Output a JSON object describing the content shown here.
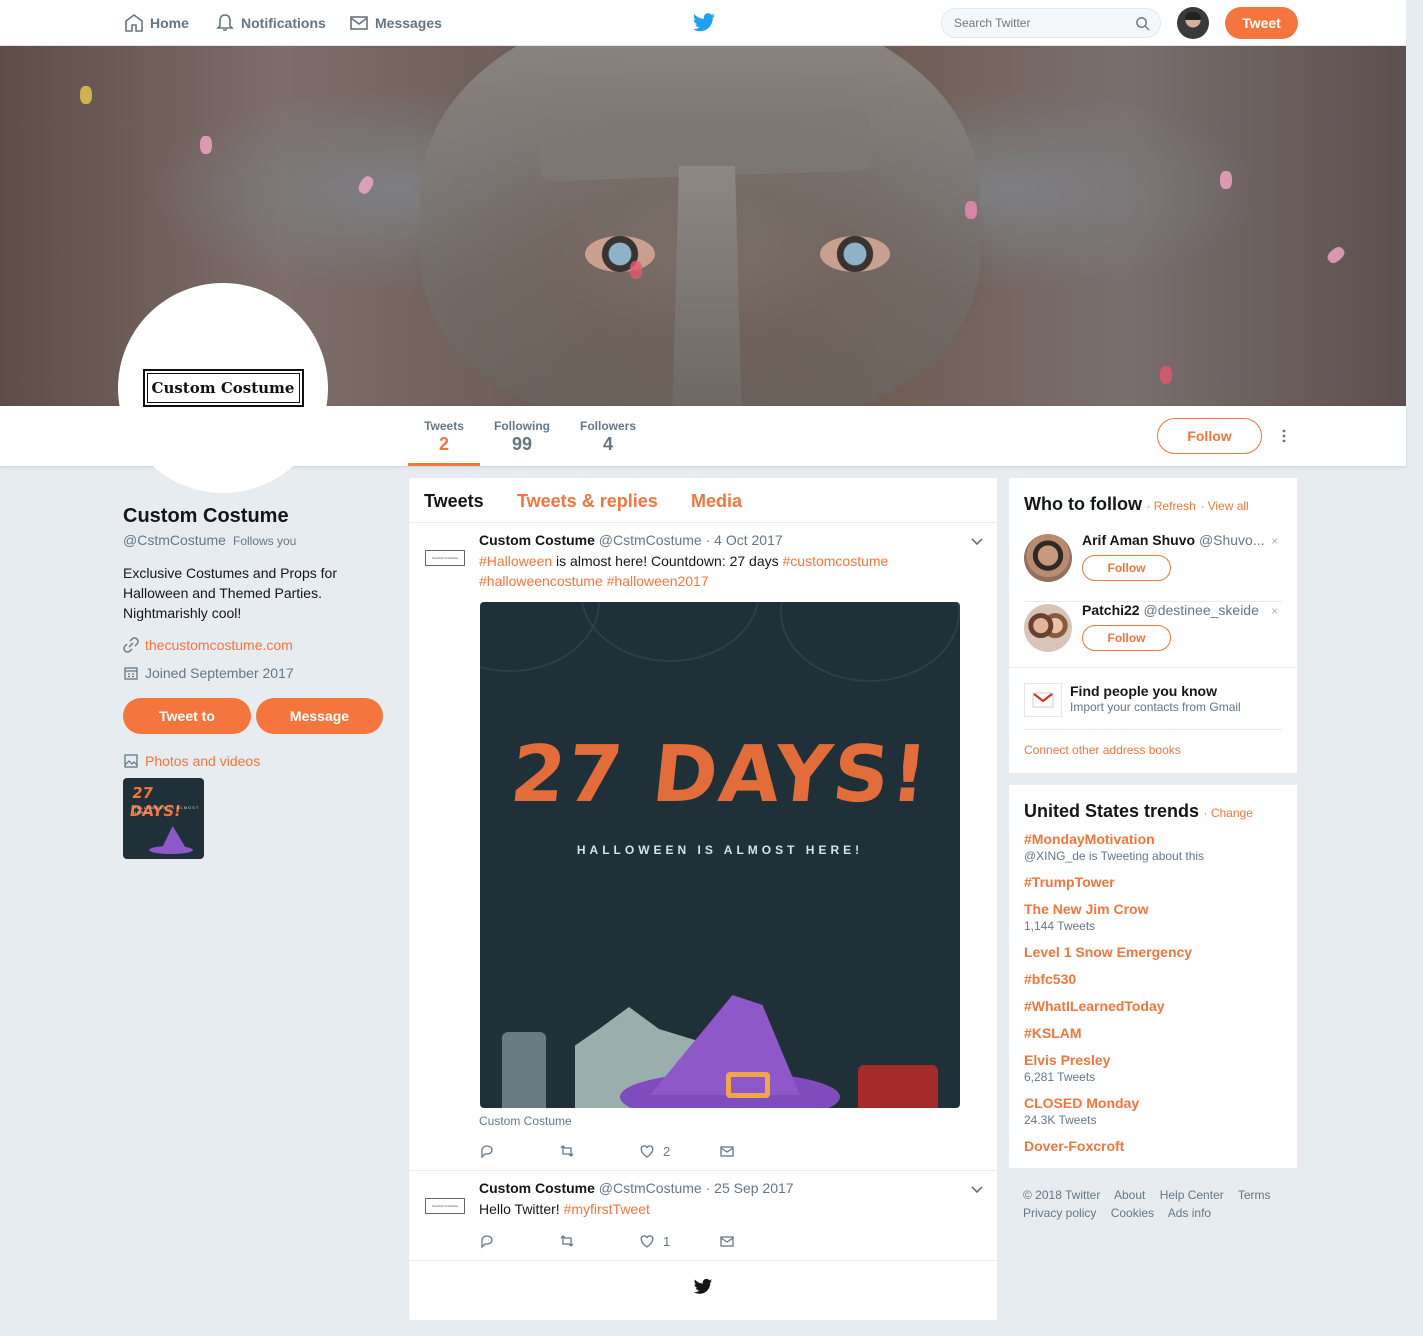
{
  "nav": {
    "home": "Home",
    "notifications": "Notifications",
    "messages": "Messages",
    "search_placeholder": "Search Twitter",
    "tweet_button": "Tweet"
  },
  "profile": {
    "logo_text": "Custom Costume",
    "name": "Custom Costume",
    "handle": "@CstmCostume",
    "follows_you": "Follows you",
    "bio": "Exclusive Costumes and Props for Halloween and Themed Parties. Nightmarishly cool!",
    "website": "thecustomcostume.com",
    "joined": "Joined September 2017",
    "tweet_to": "Tweet to",
    "message": "Message",
    "photos_videos": "Photos and videos",
    "thumb_title": "27 DAYS!",
    "thumb_sub": "HALLOWEEN IS ALMOST HERE!"
  },
  "stats": {
    "tweets_label": "Tweets",
    "tweets": "2",
    "following_label": "Following",
    "following": "99",
    "followers_label": "Followers",
    "followers": "4",
    "follow_button": "Follow"
  },
  "timeline": {
    "tabs": [
      "Tweets",
      "Tweets & replies",
      "Media"
    ],
    "tweets": [
      {
        "name": "Custom Costume",
        "handle": "@CstmCostume",
        "date": "4 Oct 2017",
        "text_parts": [
          "#Halloween",
          " is almost here! Countdown: 27 days ",
          "#customcostume",
          "#halloweencostume",
          " ",
          "#halloween2017"
        ],
        "media_title": "27 DAYS!",
        "media_sub": "HALLOWEEN IS ALMOST HERE!",
        "media_caption": "Custom Costume",
        "likes": "2"
      },
      {
        "name": "Custom Costume",
        "handle": "@CstmCostume",
        "date": "25 Sep 2017",
        "text_parts": [
          "Hello Twitter! ",
          "#myfirstTweet"
        ],
        "likes": "1"
      }
    ]
  },
  "who_to_follow": {
    "title": "Who to follow",
    "refresh": "Refresh",
    "view_all": "View all",
    "users": [
      {
        "name": "Arif Aman Shuvo",
        "handle": "@Shuvo...",
        "follow": "Follow"
      },
      {
        "name": "Patchi22",
        "handle": "@destinee_skeide",
        "follow": "Follow"
      }
    ],
    "find_title": "Find people you know",
    "find_sub": "Import your contacts from Gmail",
    "connect": "Connect other address books"
  },
  "trends": {
    "title": "United States trends",
    "change": "Change",
    "items": [
      {
        "name": "#MondayMotivation",
        "meta": "@XING_de is Tweeting about this"
      },
      {
        "name": "#TrumpTower",
        "meta": ""
      },
      {
        "name": "The New Jim Crow",
        "meta": "1,144 Tweets"
      },
      {
        "name": "Level 1 Snow Emergency",
        "meta": ""
      },
      {
        "name": "#bfc530",
        "meta": ""
      },
      {
        "name": "#WhatILearnedToday",
        "meta": ""
      },
      {
        "name": "#KSLAM",
        "meta": ""
      },
      {
        "name": "Elvis Presley",
        "meta": "6,281 Tweets"
      },
      {
        "name": "CLOSED Monday",
        "meta": "24.3K Tweets"
      },
      {
        "name": "Dover-Foxcroft",
        "meta": ""
      }
    ]
  },
  "footer": {
    "links": [
      "© 2018 Twitter",
      "About",
      "Help Center",
      "Terms",
      "Privacy policy",
      "Cookies",
      "Ads info"
    ]
  },
  "colors": {
    "accent": "#f4753d",
    "background": "#e6ecf0",
    "bird": "#1da1f2"
  }
}
